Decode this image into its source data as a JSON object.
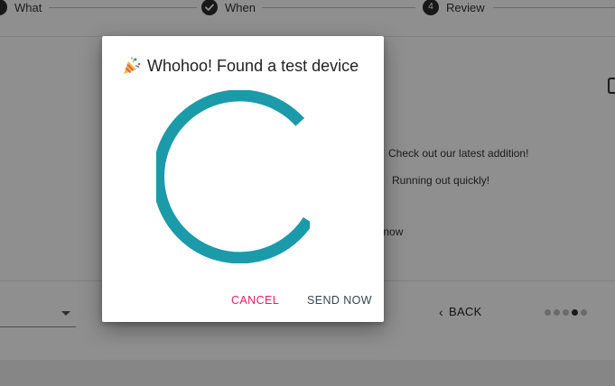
{
  "stepper": {
    "steps": [
      {
        "label": "What",
        "state": "active"
      },
      {
        "label": "When",
        "state": "done",
        "icon": "check-icon"
      },
      {
        "label": "Review",
        "state": "current",
        "number": "4"
      }
    ]
  },
  "background": {
    "labels": [
      "Check out our latest addition!",
      "Running out quickly!",
      "nt now"
    ],
    "bottom": {
      "back_label": "BACK",
      "progress": {
        "total": 5,
        "active_index": 3
      }
    }
  },
  "dialog": {
    "title_icon": "party-popper-icon",
    "title": "Whohoo! Found a test device",
    "spinner_color": "#1b9aaa",
    "cancel_label": "CANCEL",
    "send_label": "SEND NOW"
  },
  "colors": {
    "accent": "#1b9aaa",
    "cancel": "#e91e63",
    "send": "#37474f"
  }
}
